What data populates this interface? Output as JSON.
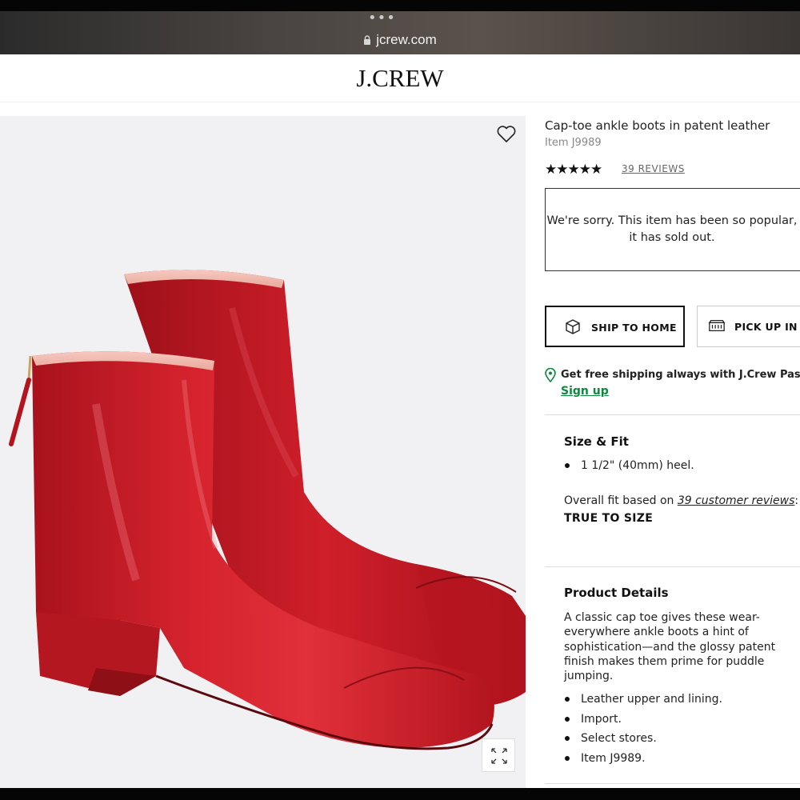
{
  "browser": {
    "url": "jcrew.com"
  },
  "header": {
    "logo": "J.CREW"
  },
  "product": {
    "title": "Cap-toe ankle boots in patent leather",
    "item_number": "Item J9989",
    "rating": {
      "stars": "★★★★★",
      "value": 5,
      "reviews_link": "39 REVIEWS"
    },
    "sold_out_message": "We're sorry. This item has been so popular, it has sold out.",
    "color": "#c8202b"
  },
  "fulfillment": {
    "ship_to_home": "SHIP TO HOME",
    "pick_up": "PICK UP IN ST"
  },
  "passport": {
    "text": "Get free shipping always with J.Crew Passp",
    "sign_up": "Sign up"
  },
  "size_fit": {
    "heading": "Size & Fit",
    "bullets": [
      "1 1/2\" (40mm) heel."
    ],
    "overall_prefix": "Overall fit based on ",
    "overall_link": "39 customer reviews",
    "overall_suffix": ":",
    "fit_value": "TRUE TO SIZE"
  },
  "details": {
    "heading": "Product Details",
    "description": "A classic cap toe gives these wear-everywhere ankle boots a hint of sophistication—and the glossy patent finish makes them prime for puddle jumping.",
    "bullets": [
      "Leather upper and lining.",
      "Import.",
      "Select stores.",
      "Item J9989."
    ]
  },
  "icons": {
    "lock": "lock-icon",
    "heart": "heart-icon",
    "expand": "expand-icon",
    "box": "box-icon",
    "store": "store-icon",
    "pin": "location-pin-icon"
  },
  "colors": {
    "accent_green": "#0a8a3c",
    "boot_red": "#c8202b",
    "image_bg": "#f1f1f3"
  }
}
